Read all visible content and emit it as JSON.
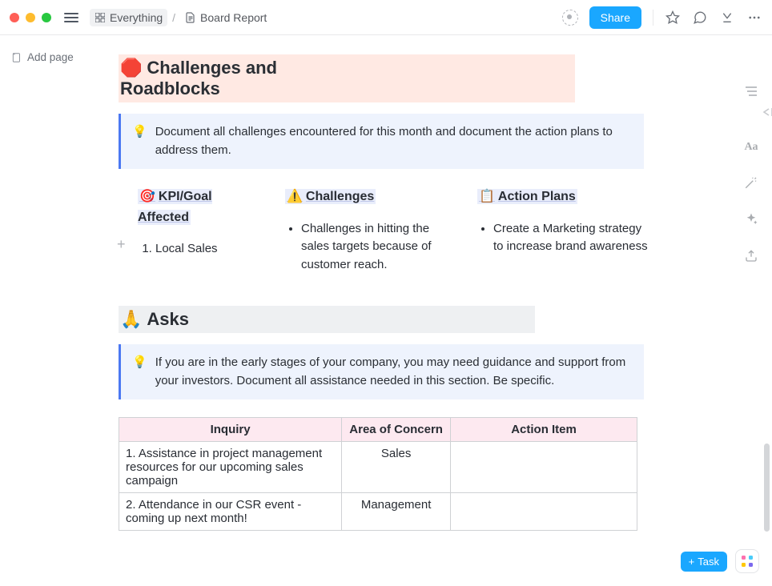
{
  "topbar": {
    "breadcrumb": {
      "root": "Everything",
      "page": "Board Report"
    },
    "share_label": "Share"
  },
  "left": {
    "add_page": "Add page"
  },
  "right_rail": {
    "text_style": "Aa"
  },
  "sections": {
    "challenges": {
      "emoji": "🛑",
      "title": "Challenges and Roadblocks",
      "callout": "Document all challenges encountered for this month and document the action plans to address them.",
      "cols": [
        {
          "emoji": "🎯",
          "heading": "KPI/Goal Affected",
          "type": "ol",
          "items": [
            "Local Sales"
          ]
        },
        {
          "emoji": "⚠️",
          "heading": "Challenges",
          "type": "ul",
          "items": [
            "Challenges in hitting the sales targets because of customer reach."
          ]
        },
        {
          "emoji": "📋",
          "heading": "Action Plans",
          "type": "ul",
          "items": [
            "Create a Marketing strategy to increase brand awareness"
          ]
        }
      ]
    },
    "asks": {
      "emoji": "🙏",
      "title": "Asks",
      "callout": "If you are in the early stages of your company, you may need guidance and support from your investors. Document all assistance needed in this section. Be specific.",
      "table": {
        "headers": [
          "Inquiry",
          "Area of Concern",
          "Action Item"
        ],
        "rows": [
          {
            "inquiry": "1. Assistance in project management resources for our upcoming sales campaign",
            "area": "Sales",
            "action": ""
          },
          {
            "inquiry": "2. Attendance in our CSR event - coming up next month!",
            "area": "Management",
            "action": ""
          }
        ]
      }
    }
  },
  "float": {
    "task_label": "Task"
  }
}
